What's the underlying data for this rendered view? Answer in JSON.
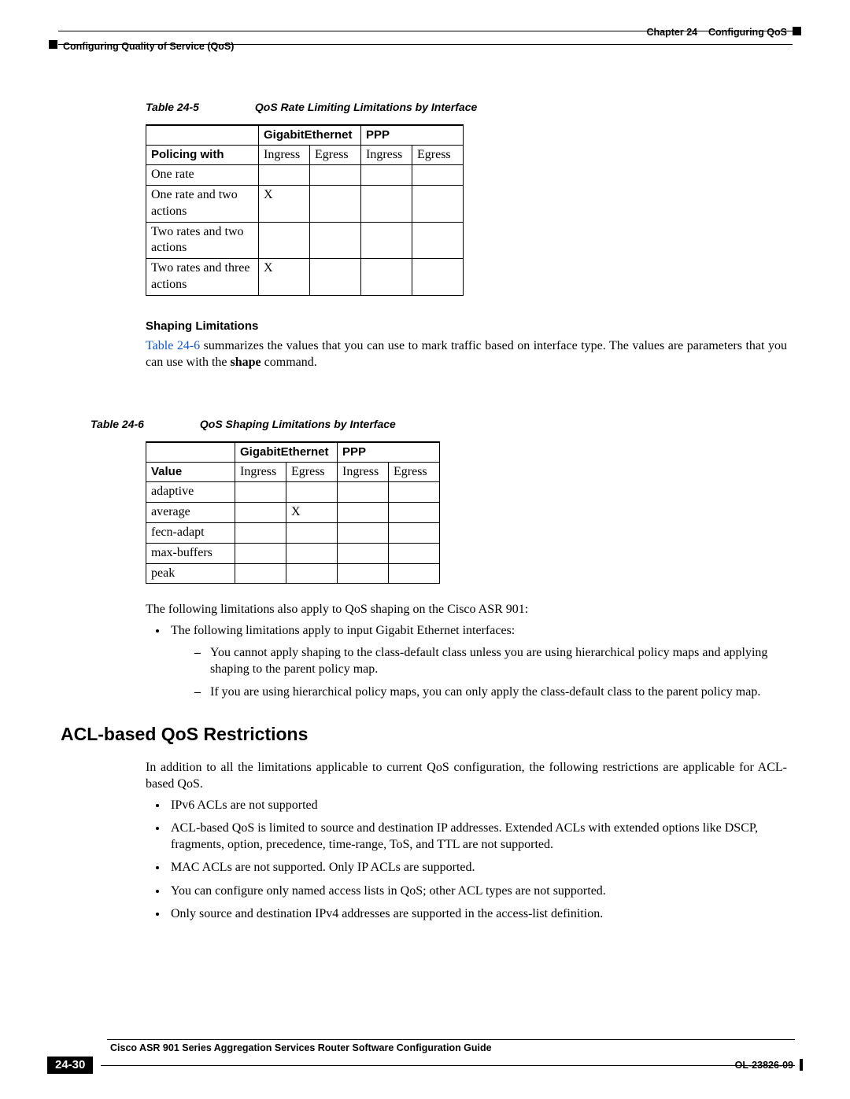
{
  "header": {
    "chapter_label": "Chapter 24",
    "chapter_title": "Configuring QoS",
    "section_title": "Configuring Quality of Service (QoS)"
  },
  "table5": {
    "caption_label": "Table 24-5",
    "caption_text": "QoS Rate Limiting Limitations by Interface",
    "col_group1": "GigabitEthernet",
    "col_group2": "PPP",
    "row_head": "Policing with",
    "sub_ingress": "Ingress",
    "sub_egress": "Egress",
    "rows": [
      {
        "label": "One rate",
        "c1": "",
        "c2": "",
        "c3": "",
        "c4": ""
      },
      {
        "label": "One rate and two actions",
        "c1": "X",
        "c2": "",
        "c3": "",
        "c4": ""
      },
      {
        "label": "Two rates and two actions",
        "c1": "",
        "c2": "",
        "c3": "",
        "c4": ""
      },
      {
        "label": "Two rates and three actions",
        "c1": "X",
        "c2": "",
        "c3": "",
        "c4": ""
      }
    ]
  },
  "shaping": {
    "heading": "Shaping Limitations",
    "para_link": "Table 24-6",
    "para_rest1": " summarizes the values that you can use to mark traffic based on interface type. The values are parameters that you can use with the ",
    "para_bold": "shape",
    "para_rest2": " command."
  },
  "table6": {
    "caption_label": "Table 24-6",
    "caption_text": "QoS Shaping Limitations by Interface",
    "col_group1": "GigabitEthernet",
    "col_group2": "PPP",
    "row_head": "Value",
    "sub_ingress": "Ingress",
    "sub_egress": "Egress",
    "rows": [
      {
        "label": "adaptive",
        "c1": "",
        "c2": "",
        "c3": "",
        "c4": ""
      },
      {
        "label": "average",
        "c1": "",
        "c2": "X",
        "c3": "",
        "c4": ""
      },
      {
        "label": "fecn-adapt",
        "c1": "",
        "c2": "",
        "c3": "",
        "c4": ""
      },
      {
        "label": "max-buffers",
        "c1": "",
        "c2": "",
        "c3": "",
        "c4": ""
      },
      {
        "label": "peak",
        "c1": "",
        "c2": "",
        "c3": "",
        "c4": ""
      }
    ]
  },
  "followpara": "The following limitations also apply to QoS shaping on the Cisco ASR 901:",
  "bullets_main": [
    "The following limitations apply to input Gigabit Ethernet interfaces:"
  ],
  "bullets_sub": [
    "You cannot apply shaping to the class-default class unless you are using hierarchical policy maps and applying shaping to the parent policy map.",
    "If you are using hierarchical policy maps, you can only apply the class-default class to the parent policy map."
  ],
  "acl": {
    "heading": "ACL-based QoS Restrictions",
    "intro": "In addition to all the limitations applicable to current QoS configuration, the following restrictions are applicable for ACL-based QoS.",
    "items": [
      "IPv6 ACLs are not supported",
      "ACL-based QoS is limited to source and destination IP addresses. Extended ACLs with extended options like DSCP, fragments, option, precedence, time-range, ToS, and TTL are not supported.",
      "MAC ACLs are not supported. Only IP ACLs are supported.",
      "You can configure only named access lists in QoS; other ACL types are not supported.",
      "Only source and destination IPv4 addresses are supported in the access-list definition."
    ]
  },
  "footer": {
    "guide": "Cisco ASR 901 Series Aggregation Services Router Software Configuration Guide",
    "page": "24-30",
    "docid": "OL-23826-09"
  }
}
